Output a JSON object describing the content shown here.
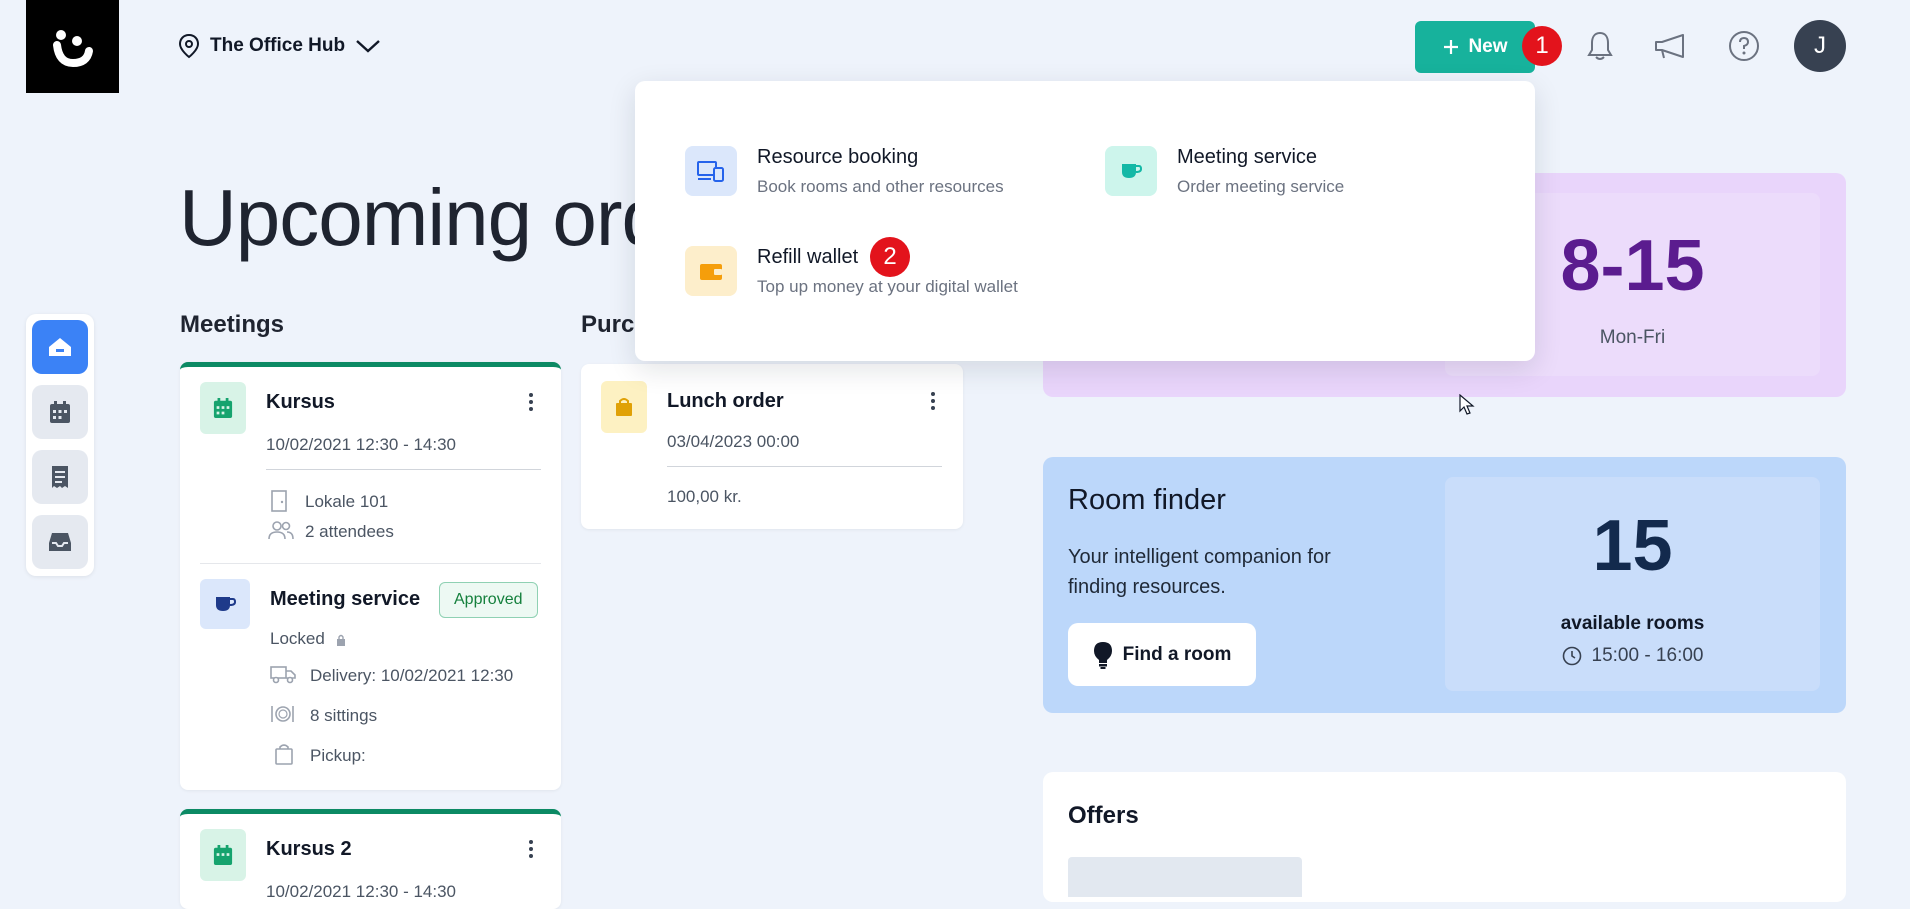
{
  "header": {
    "location": "The Office Hub",
    "new_label": "New",
    "step1": "1",
    "avatar_initial": "J"
  },
  "page": {
    "title": "Upcoming ord"
  },
  "columns": {
    "meetings": "Meetings",
    "purchases": "Purc"
  },
  "meetings": [
    {
      "name": "Kursus",
      "datetime": "10/02/2021 12:30 - 14:30",
      "room": "Lokale 101",
      "attendees": "2 attendees",
      "service": {
        "name": "Meeting service",
        "status": "Approved",
        "locked": "Locked",
        "delivery": "Delivery: 10/02/2021 12:30",
        "sittings": "8 sittings",
        "pickup": "Pickup:"
      }
    },
    {
      "name": "Kursus 2",
      "datetime": "10/02/2021 12:30 - 14:30"
    }
  ],
  "purchases": [
    {
      "name": "Lunch order",
      "datetime": "03/04/2023 00:00",
      "price": "100,00 kr."
    }
  ],
  "hours_widget": {
    "hours": "8-15",
    "days": "Mon-Fri"
  },
  "room_finder": {
    "title": "Room finder",
    "description": "Your intelligent companion for finding resources.",
    "button": "Find a room",
    "count": "15",
    "count_label": "available rooms",
    "time": "15:00 - 16:00"
  },
  "offers": {
    "title": "Offers"
  },
  "dropdown": {
    "items": [
      {
        "title": "Resource booking",
        "desc": "Book rooms and other resources"
      },
      {
        "title": "Meeting service",
        "desc": "Order meeting service"
      },
      {
        "title": "Refill wallet",
        "desc": "Top up money at your digital wallet"
      }
    ],
    "step2": "2"
  },
  "colors": {
    "accent": "#17b29c",
    "badge": "#e3131c",
    "meeting_top": "#0c8a64",
    "purple_text": "#5b1c8f",
    "navy_text": "#132a4d"
  },
  "icons": [
    "logo-icon",
    "location-pin-icon",
    "chevron-down-icon",
    "plus-icon",
    "bell-icon",
    "megaphone-icon",
    "help-icon",
    "home-icon",
    "calendar-icon",
    "receipt-icon",
    "inbox-icon",
    "more-vertical-icon",
    "door-icon",
    "people-icon",
    "coffee-cup-icon",
    "lock-icon",
    "truck-icon",
    "plate-icon",
    "bag-icon",
    "lightbulb-icon",
    "clock-icon",
    "devices-icon",
    "wallet-icon",
    "cursor-icon"
  ]
}
